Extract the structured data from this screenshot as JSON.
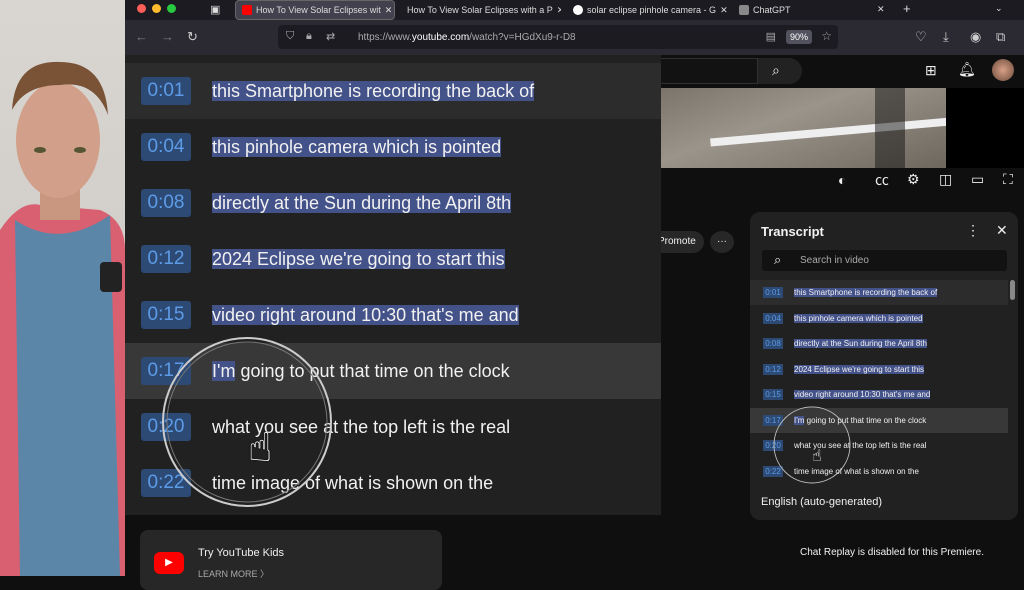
{
  "browser": {
    "tabs": [
      {
        "label": "How To View Solar Eclipses wit",
        "active": true,
        "favicon": "youtube-icon"
      },
      {
        "label": "How To View Solar Eclipses with a P",
        "active": false,
        "favicon": "none"
      },
      {
        "label": "solar eclipse pinhole camera - G",
        "active": false,
        "favicon": "google-icon"
      },
      {
        "label": "ChatGPT",
        "active": false,
        "favicon": "chatgpt-icon"
      }
    ],
    "url_prefix": "https://www.",
    "url_domain": "youtube.com",
    "url_path": "/watch?v=HGdXu9-r-D8",
    "zoom": "90%"
  },
  "transcript": {
    "title": "Transcript",
    "search_placeholder": "Search in video",
    "language": "English (auto-generated)",
    "rows": [
      {
        "time": "0:01",
        "text": "this Smartphone is recording the back of"
      },
      {
        "time": "0:04",
        "text": "this pinhole camera which is pointed"
      },
      {
        "time": "0:08",
        "text": "directly at the Sun during the April 8th"
      },
      {
        "time": "0:12",
        "text": "2024 Eclipse we're going to start this"
      },
      {
        "time": "0:15",
        "text": "video right around 10:30 that's me and"
      },
      {
        "time": "0:17",
        "text_sel": "I'm",
        "text": " going to put that time on the clock"
      },
      {
        "time": "0:20",
        "text": "what you see at the top left is the real"
      },
      {
        "time": "0:22",
        "text": "time image of what is shown on the"
      }
    ]
  },
  "actions": {
    "promote": "Promote",
    "more": "···"
  },
  "kids": {
    "title": "Try YouTube Kids",
    "link": "LEARN MORE"
  },
  "chat": {
    "notice": "Chat Replay is disabled for this Premiere."
  },
  "colors": {
    "timestamp": "#5d9be6",
    "selection": "#44528a",
    "youtube_red": "#ff0000"
  }
}
